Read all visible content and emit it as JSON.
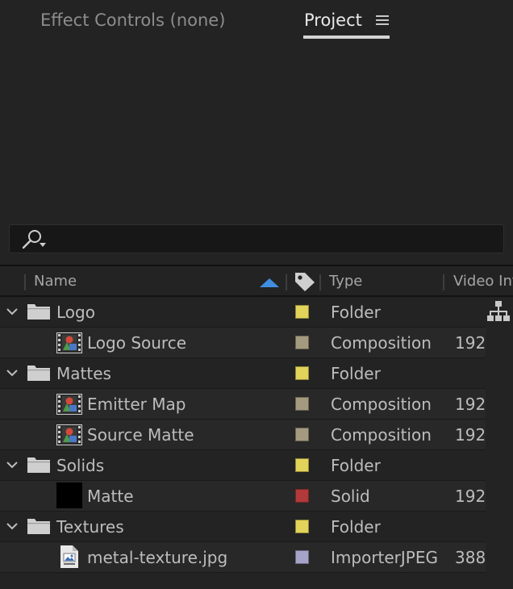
{
  "tabs": {
    "effect_controls": "Effect Controls (none)",
    "project": "Project"
  },
  "search": {
    "value": "",
    "placeholder": ""
  },
  "columns": {
    "name": "Name",
    "type": "Type",
    "video_info": "Video Inf"
  },
  "colors": {
    "folder_label": "#e2d35a",
    "composition_label": "#a39a80",
    "solid_label": "#b23a3a",
    "jpeg_label": "#a6a3c8",
    "sort_arrow": "#3f8ee0"
  },
  "rows": [
    {
      "kind": "folder",
      "name": "Logo",
      "type": "Folder",
      "video_info": ""
    },
    {
      "kind": "composition",
      "name": "Logo Source",
      "type": "Composition",
      "video_info": "192("
    },
    {
      "kind": "folder",
      "name": "Mattes",
      "type": "Folder",
      "video_info": ""
    },
    {
      "kind": "composition",
      "name": "Emitter Map",
      "type": "Composition",
      "video_info": "192("
    },
    {
      "kind": "composition",
      "name": "Source Matte",
      "type": "Composition",
      "video_info": "192("
    },
    {
      "kind": "folder",
      "name": "Solids",
      "type": "Folder",
      "video_info": ""
    },
    {
      "kind": "solid",
      "name": "Matte",
      "type": "Solid",
      "video_info": "192("
    },
    {
      "kind": "folder",
      "name": "Textures",
      "type": "Folder",
      "video_info": ""
    },
    {
      "kind": "jpeg",
      "name": "metal-texture.jpg",
      "type": "ImporterJPEG",
      "video_info": "388"
    }
  ],
  "icons": {
    "panel_menu": "hamburger-menu-icon",
    "search": "search-magnifier-icon",
    "sort": "sort-ascending-icon",
    "label": "label-tag-icon",
    "expand": "chevron-down-icon",
    "folder": "folder-icon",
    "composition": "composition-icon",
    "solid": "solid-icon",
    "jpeg": "image-file-icon",
    "flowchart": "flowchart-icon"
  }
}
